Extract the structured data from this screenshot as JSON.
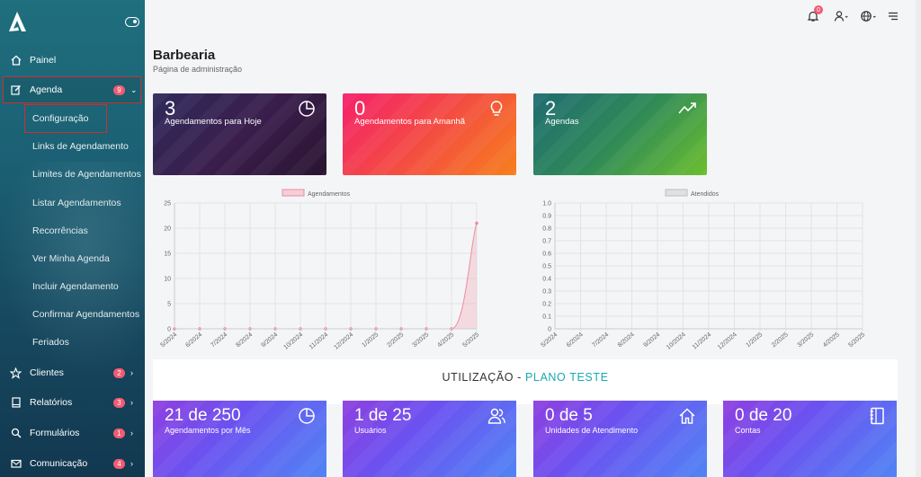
{
  "sidebar": {
    "items": [
      {
        "label": "Painel",
        "icon": "home-icon"
      },
      {
        "label": "Agenda",
        "icon": "edit-icon",
        "badge": "9"
      },
      {
        "label": "Clientes",
        "icon": "star-icon",
        "badge": "2"
      },
      {
        "label": "Relatórios",
        "icon": "book-icon",
        "badge": "3"
      },
      {
        "label": "Formulários",
        "icon": "search-icon",
        "badge": "1"
      },
      {
        "label": "Comunicação",
        "icon": "mail-icon",
        "badge": "4"
      }
    ],
    "agenda_sub": [
      "Configuração",
      "Links de Agendamento",
      "Limites de Agendamentos",
      "Listar Agendamentos",
      "Recorrências",
      "Ver Minha Agenda",
      "Incluir Agendamento",
      "Confirmar Agendamentos",
      "Feriados"
    ]
  },
  "topbar": {
    "notification_count": "0"
  },
  "header": {
    "title": "Barbearia",
    "subtitle": "Página de administração"
  },
  "cards": [
    {
      "value": "3",
      "label": "Agendamentos para Hoje",
      "icon": "pie-chart-icon"
    },
    {
      "value": "0",
      "label": "Agendamentos para Amanhã",
      "icon": "lightbulb-icon"
    },
    {
      "value": "2",
      "label": "Agendas",
      "icon": "trend-icon"
    }
  ],
  "usage": {
    "title": "UTILIZAÇÃO - ",
    "plan": "PLANO TESTE",
    "cards": [
      {
        "value": "21 de 250",
        "label": "Agendamentos por Mês",
        "icon": "pie-chart-icon"
      },
      {
        "value": "1 de 25",
        "label": "Usuários",
        "icon": "users-icon"
      },
      {
        "value": "0 de 5",
        "label": "Unidades de Atendimento",
        "icon": "house-icon"
      },
      {
        "value": "0 de 20",
        "label": "Contas",
        "icon": "notebook-icon"
      }
    ]
  },
  "chart_data": [
    {
      "type": "area",
      "categories": [
        "5/2024",
        "6/2024",
        "7/2024",
        "8/2024",
        "9/2024",
        "10/2024",
        "11/2024",
        "12/2024",
        "1/2025",
        "2/2025",
        "3/2025",
        "4/2025",
        "5/2025"
      ],
      "series": [
        {
          "name": "Agendamentos",
          "values": [
            0,
            0,
            0,
            0,
            0,
            0,
            0,
            0,
            0,
            0,
            0,
            0,
            21
          ]
        }
      ],
      "yticks": [
        "0",
        "5",
        "10",
        "15",
        "20",
        "25"
      ],
      "ylim": [
        0,
        25
      ],
      "legend": "top-center",
      "color": "#f08a9e"
    },
    {
      "type": "line",
      "categories": [
        "5/2024",
        "6/2024",
        "7/2024",
        "8/2024",
        "9/2024",
        "10/2024",
        "11/2024",
        "12/2024",
        "1/2025",
        "2/2025",
        "3/2025",
        "4/2025",
        "5/2025"
      ],
      "series": [
        {
          "name": "Atendidos",
          "values": []
        }
      ],
      "yticks": [
        "0",
        "0.1",
        "0.2",
        "0.3",
        "0.4",
        "0.5",
        "0.6",
        "0.7",
        "0.8",
        "0.9",
        "1.0"
      ],
      "ylim": [
        0,
        1
      ],
      "legend": "top-center",
      "color": "#bdbdbd"
    }
  ]
}
